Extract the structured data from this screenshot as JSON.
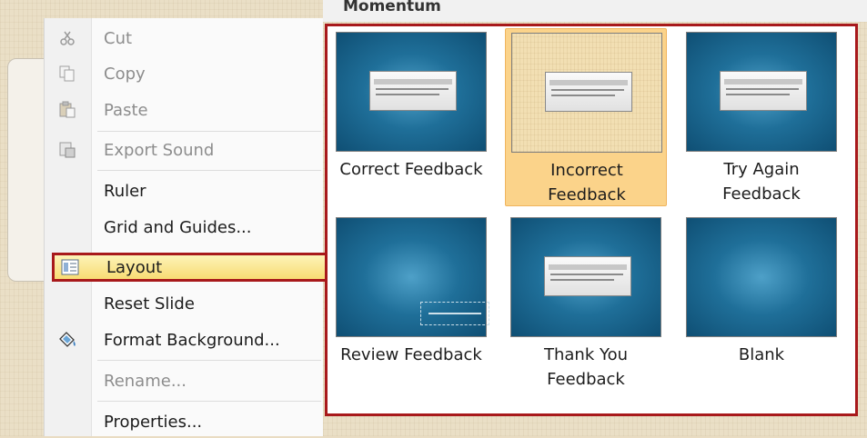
{
  "gallery": {
    "title": "Momentum",
    "layouts": [
      {
        "caption": "Correct Feedback",
        "selected": false,
        "style": "blue-box"
      },
      {
        "caption": "Incorrect Feedback",
        "selected": true,
        "style": "beige-box"
      },
      {
        "caption": "Try Again Feedback",
        "selected": false,
        "style": "blue-box"
      },
      {
        "caption": "Review Feedback",
        "selected": false,
        "style": "blue-dashed"
      },
      {
        "caption": "Thank You Feedback",
        "selected": false,
        "style": "blue-box"
      },
      {
        "caption": "Blank",
        "selected": false,
        "style": "blue-plain"
      }
    ]
  },
  "menu": {
    "items": [
      {
        "label": "Cut",
        "enabled": false,
        "icon": "scissors-icon"
      },
      {
        "label": "Copy",
        "enabled": false,
        "icon": "copy-icon"
      },
      {
        "label": "Paste",
        "enabled": false,
        "icon": "paste-icon"
      },
      {
        "label": "Export Sound",
        "enabled": false,
        "icon": "export-sound-icon"
      },
      {
        "label": "Ruler",
        "enabled": true
      },
      {
        "label": "Grid and Guides...",
        "enabled": true
      },
      {
        "label": "Layout",
        "enabled": true,
        "icon": "layout-icon",
        "submenu": true,
        "highlighted": true
      },
      {
        "label": "Reset Slide",
        "enabled": true
      },
      {
        "label": "Format Background...",
        "enabled": true,
        "icon": "format-background-icon"
      },
      {
        "label": "Rename...",
        "enabled": false
      },
      {
        "label": "Properties...",
        "enabled": true
      }
    ]
  },
  "colors": {
    "highlight_border": "#a8191b",
    "selected_tile": "#fbd38a",
    "thumb_blue": "#1f6f99"
  }
}
